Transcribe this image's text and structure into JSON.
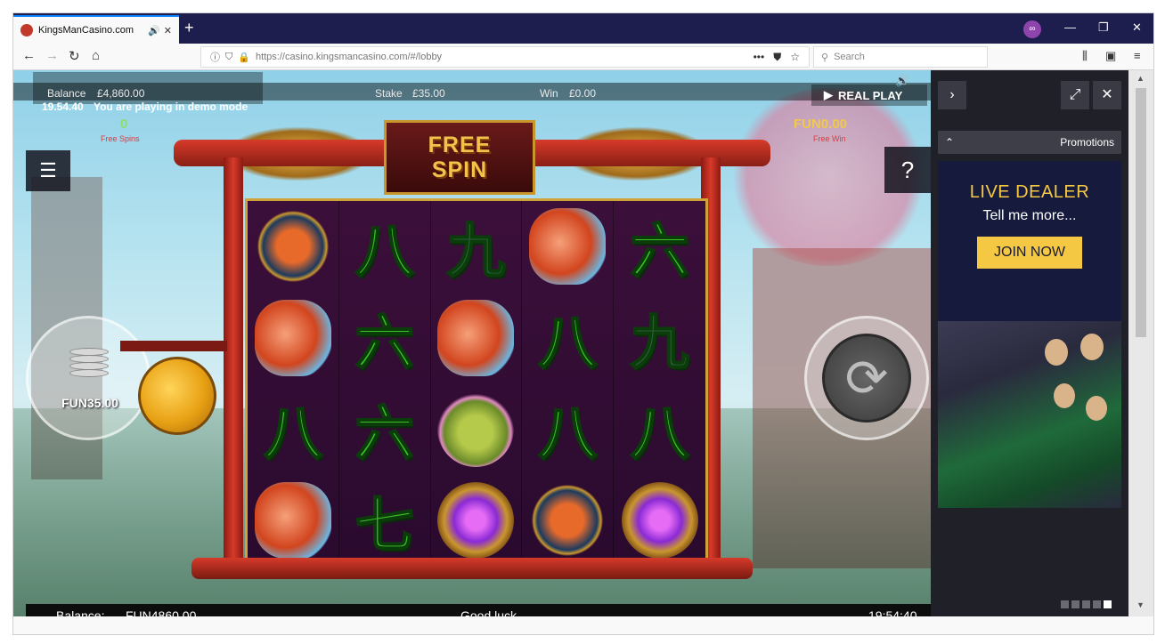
{
  "browser": {
    "tab_title": "KingsManCasino.com",
    "tab_sound_icon": "🔊",
    "tab_close_icon": "✕",
    "new_tab_icon": "+",
    "url": "https://casino.kingsmancasino.com/#/lobby",
    "search_placeholder": "Search",
    "win_minimize": "—",
    "win_restore": "❐",
    "win_close": "✕"
  },
  "game": {
    "balance_label": "Balance",
    "balance_value": "£4,860.00",
    "stake_label": "Stake",
    "stake_value": "£35.00",
    "win_label": "Win",
    "win_value": "£0.00",
    "time": "19.54.40",
    "demo_text": "You are playing in demo mode",
    "free_spins_count": "0",
    "free_spins_label": "Free Spins",
    "free_win_value": "FUN0.00",
    "free_win_label": "Free Win",
    "title_line1": "FREE",
    "title_line2": "SPIN",
    "real_play_label": "REAL PLAY",
    "help_label": "?",
    "stake_fun": "FUN35.00",
    "status_balance_label": "Balance:",
    "status_balance_value": "FUN4860.00",
    "status_message": "Good luck",
    "status_time": "19:54:40",
    "reels": [
      [
        "monkey",
        "八",
        "九",
        "koi",
        "六"
      ],
      [
        "koi",
        "六",
        "koi",
        "八",
        "九"
      ],
      [
        "八",
        "六",
        "frog",
        "八",
        "八"
      ],
      [
        "koi",
        "七",
        "orb",
        "monkey",
        "orb"
      ]
    ],
    "glyph_color": "#3fbf2a"
  },
  "promotions": {
    "header_label": "Promotions",
    "banner_title": "LIVE DEALER",
    "banner_sub": "Tell me more...",
    "join_label": "JOIN NOW",
    "accent": "#f4c843",
    "carousel_count": 5,
    "carousel_active": 5
  }
}
